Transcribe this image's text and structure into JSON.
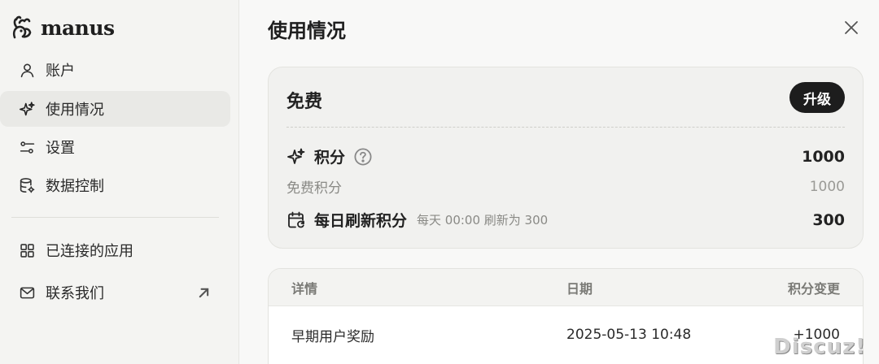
{
  "app": {
    "name": "manus"
  },
  "sidebar": {
    "items": [
      {
        "label": "账户",
        "icon": "user-icon"
      },
      {
        "label": "使用情况",
        "icon": "sparkle-icon",
        "active": true
      },
      {
        "label": "设置",
        "icon": "sliders-icon"
      },
      {
        "label": "数据控制",
        "icon": "database-gear-icon"
      },
      {
        "label": "已连接的应用",
        "icon": "grid-icon"
      },
      {
        "label": "联系我们",
        "icon": "mail-icon"
      }
    ]
  },
  "main": {
    "title": "使用情况",
    "plan": {
      "name": "免费",
      "upgrade_label": "升级",
      "credits_label": "积分",
      "credits_value": "1000",
      "free_credits_label": "免费积分",
      "free_credits_value": "1000",
      "daily_label": "每日刷新积分",
      "daily_note": "每天 00:00 刷新为 300",
      "daily_value": "300"
    },
    "table": {
      "headers": [
        "详情",
        "日期",
        "积分变更"
      ],
      "rows": [
        [
          "早期用户奖励",
          "2025-05-13 10:48",
          "+1000"
        ]
      ]
    }
  },
  "watermark": "Discuz!"
}
